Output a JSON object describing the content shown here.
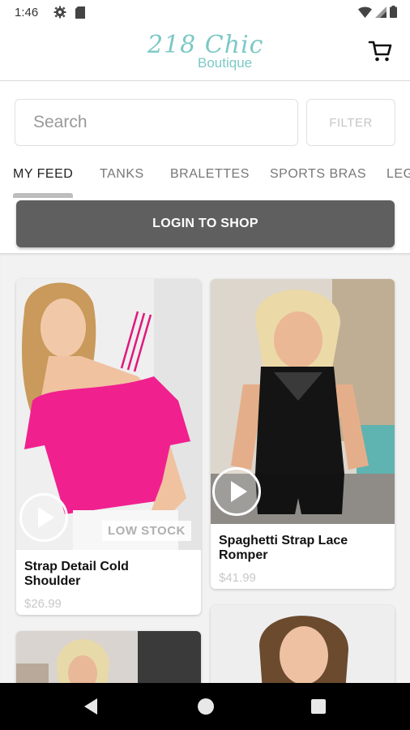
{
  "status_bar": {
    "time": "1:46",
    "icons": [
      "gear-icon",
      "sd-card-icon",
      "wifi-icon",
      "signal-icon",
      "battery-icon"
    ]
  },
  "header": {
    "logo_script": "218 Chic",
    "logo_sub": "Boutique",
    "brand_color": "#7cc9c6",
    "cart_icon": "cart-icon"
  },
  "search": {
    "placeholder": "Search",
    "value": ""
  },
  "filter": {
    "label": "FILTER"
  },
  "tabs": [
    {
      "label": "MY FEED",
      "active": true
    },
    {
      "label": "TANKS",
      "active": false
    },
    {
      "label": "BRALETTES",
      "active": false
    },
    {
      "label": "SPORTS BRAS",
      "active": false
    },
    {
      "label": "LEG",
      "active": false
    }
  ],
  "login_button": {
    "label": "LOGIN TO SHOP",
    "color": "#5f5f5f"
  },
  "products": [
    {
      "title_lines": [
        "Strap Detail Cold",
        "Shoulder"
      ],
      "price": "$26.99",
      "badge": "LOW STOCK",
      "has_video": true,
      "shirt_color": "#f0208f"
    },
    {
      "title_lines": [
        "Spaghetti Strap Lace",
        "Romper"
      ],
      "price": "$41.99",
      "badge": "",
      "has_video": true,
      "shirt_color": "#141414"
    },
    {
      "title_lines": [],
      "price": "",
      "badge": "",
      "has_video": false
    },
    {
      "title_lines": [],
      "price": "",
      "badge": "",
      "has_video": false
    }
  ],
  "nav": {
    "icons": [
      "back-icon",
      "home-icon",
      "recents-icon"
    ]
  }
}
